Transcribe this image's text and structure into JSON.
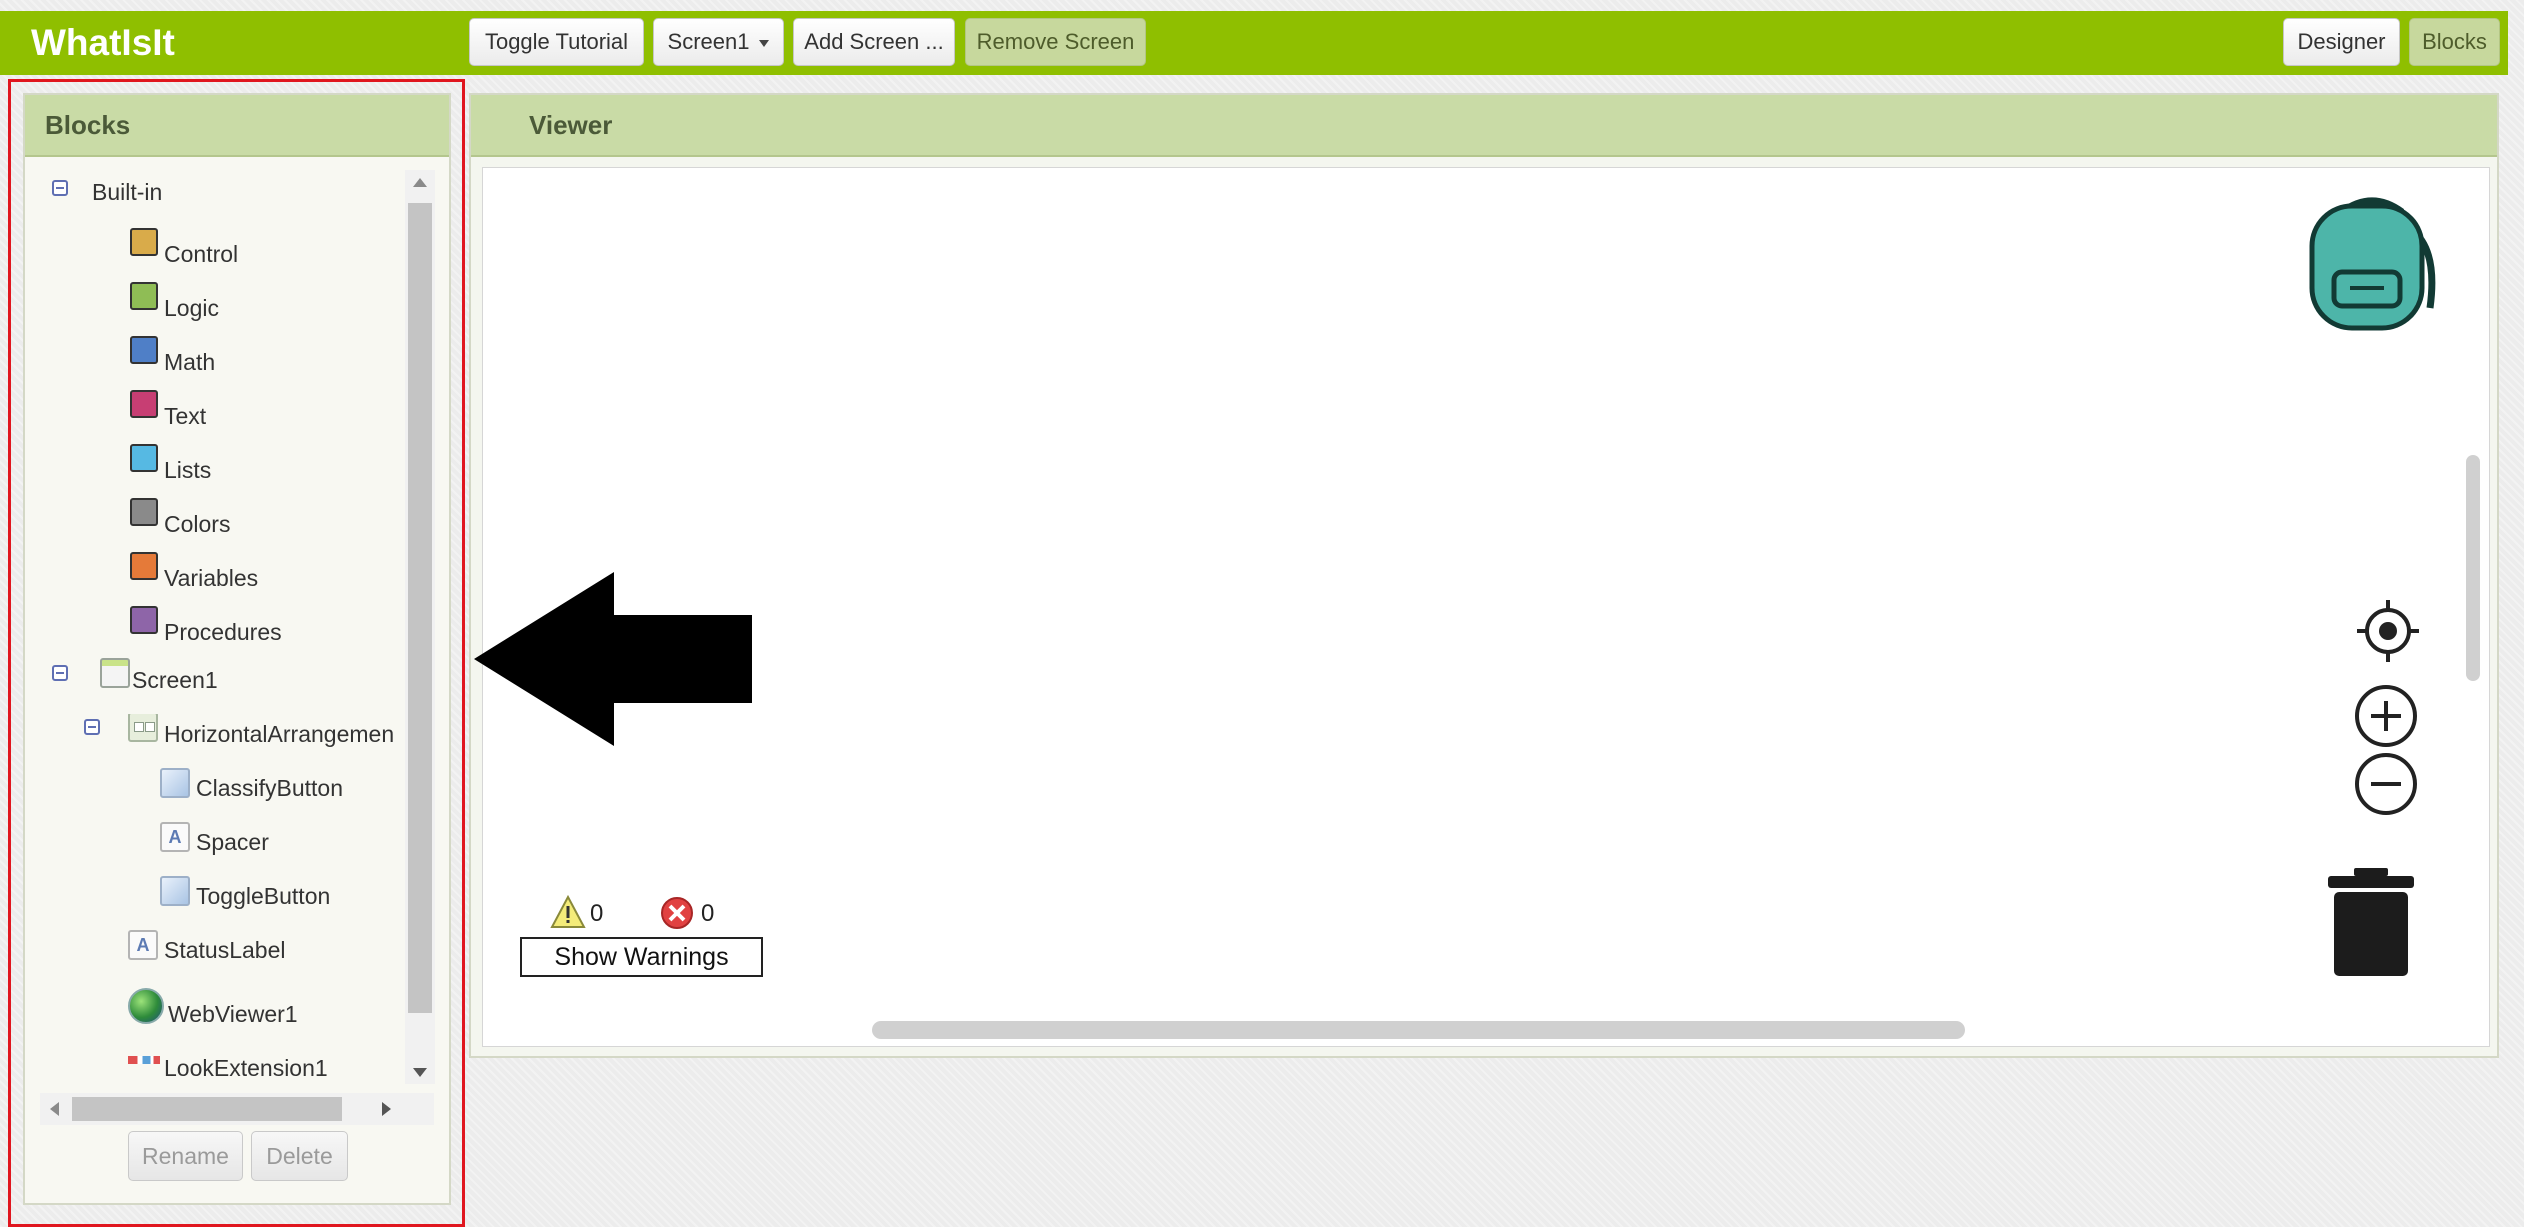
{
  "app": {
    "title": "WhatIsIt"
  },
  "toolbar": {
    "toggle_tutorial": "Toggle Tutorial",
    "screen_select": "Screen1",
    "add_screen": "Add Screen ...",
    "remove_screen": "Remove Screen",
    "designer": "Designer",
    "blocks": "Blocks"
  },
  "blocks_panel": {
    "title": "Blocks",
    "builtin": {
      "label": "Built-in",
      "items": [
        {
          "label": "Control",
          "color": "#d9ab4a"
        },
        {
          "label": "Logic",
          "color": "#8fbd55"
        },
        {
          "label": "Math",
          "color": "#4f7fc7"
        },
        {
          "label": "Text",
          "color": "#c73e73"
        },
        {
          "label": "Lists",
          "color": "#56b9e3"
        },
        {
          "label": "Colors",
          "color": "#8a8a8a"
        },
        {
          "label": "Variables",
          "color": "#e57a39"
        },
        {
          "label": "Procedures",
          "color": "#8e65a8"
        }
      ]
    },
    "components": {
      "screen": "Screen1",
      "arrangement": "HorizontalArrangemen",
      "classify_button": "ClassifyButton",
      "spacer": "Spacer",
      "toggle_button": "ToggleButton",
      "status_label": "StatusLabel",
      "web_viewer": "WebViewer1",
      "look_extension": "LookExtension1"
    },
    "rename_button": "Rename",
    "delete_button": "Delete"
  },
  "viewer": {
    "title": "Viewer",
    "warning_count": "0",
    "error_count": "0",
    "show_warnings": "Show Warnings"
  },
  "colors": {
    "topbar": "#8fbf00",
    "panel_header": "#c9dba6",
    "highlight": "#e0161f",
    "backpack": "#4db5a9",
    "trash": "#1c1c1c"
  }
}
